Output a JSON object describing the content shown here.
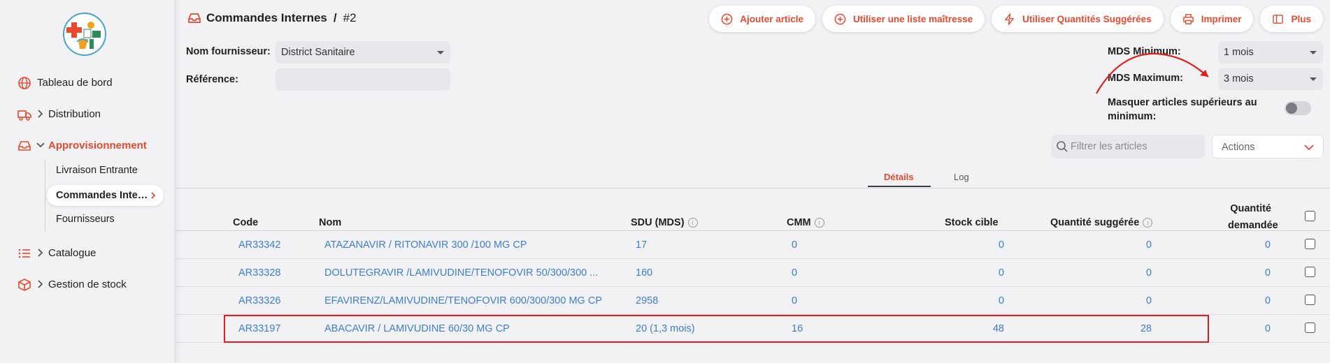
{
  "sidebar": {
    "items": [
      {
        "label": "Tableau de bord",
        "icon": "globe-icon"
      },
      {
        "label": "Distribution",
        "icon": "truck-icon"
      },
      {
        "label": "Approvisionnement",
        "icon": "inbox-icon"
      },
      {
        "label": "Catalogue",
        "icon": "list-icon"
      },
      {
        "label": "Gestion de stock",
        "icon": "box-icon"
      }
    ],
    "sub_items": [
      "Livraison Entrante",
      "Commandes Internes",
      "Fournisseurs"
    ],
    "active_sub": "Commandes Internes"
  },
  "header": {
    "title": "Commandes Internes",
    "separator": "/",
    "number": "#2"
  },
  "toolbar": {
    "add_item": "Ajouter article",
    "master_list": "Utiliser une liste maîtresse",
    "suggested_qty": "Utiliser Quantités Suggérées",
    "print": "Imprimer",
    "more": "Plus"
  },
  "form": {
    "supplier_label": "Nom fournisseur:",
    "supplier_value": "District Sanitaire",
    "reference_label": "Référence:",
    "reference_value": "",
    "mds_min_label": "MDS Minimum:",
    "mds_min_value": "1 mois",
    "mds_max_label": "MDS Maximum:",
    "mds_max_value": "3 mois",
    "hide_label_1": "Masquer articles supérieurs au",
    "hide_label_2": "minimum:",
    "hide_on": false,
    "search_placeholder": "Filtrer les articles",
    "actions_label": "Actions"
  },
  "tabs": {
    "details": "Détails",
    "log": "Log"
  },
  "table": {
    "headers": {
      "code": "Code",
      "name": "Nom",
      "sdu": "SDU (MDS)",
      "cmm": "CMM",
      "target": "Stock cible",
      "suggested": "Quantité suggérée",
      "requested_1": "Quantité",
      "requested_2": "demandée",
      "info": "i"
    },
    "rows": [
      {
        "code": "AR33342",
        "name": "ATAZANAVIR / RITONAVIR 300 /100 MG CP",
        "sdu": "17",
        "cmm": "0",
        "target": "0",
        "suggested": "0",
        "requested": "0"
      },
      {
        "code": "AR33328",
        "name": "DOLUTEGRAVIR /LAMIVUDINE/TENOFOVIR 50/300/300 ...",
        "sdu": "160",
        "cmm": "0",
        "target": "0",
        "suggested": "0",
        "requested": "0"
      },
      {
        "code": "AR33326",
        "name": "EFAVIRENZ/LAMIVUDINE/TENOFOVIR 600/300/300 MG CP",
        "sdu": "2958",
        "cmm": "0",
        "target": "0",
        "suggested": "0",
        "requested": "0"
      },
      {
        "code": "AR33197",
        "name": "ABACAVIR / LAMIVUDINE 60/30 MG CP",
        "sdu": "20 (1,3 mois)",
        "cmm": "16",
        "target": "48",
        "suggested": "28",
        "requested": "0"
      }
    ]
  },
  "colors": {
    "accent": "#e8492f",
    "link": "#3b7fd3",
    "annotation": "#e02020"
  }
}
